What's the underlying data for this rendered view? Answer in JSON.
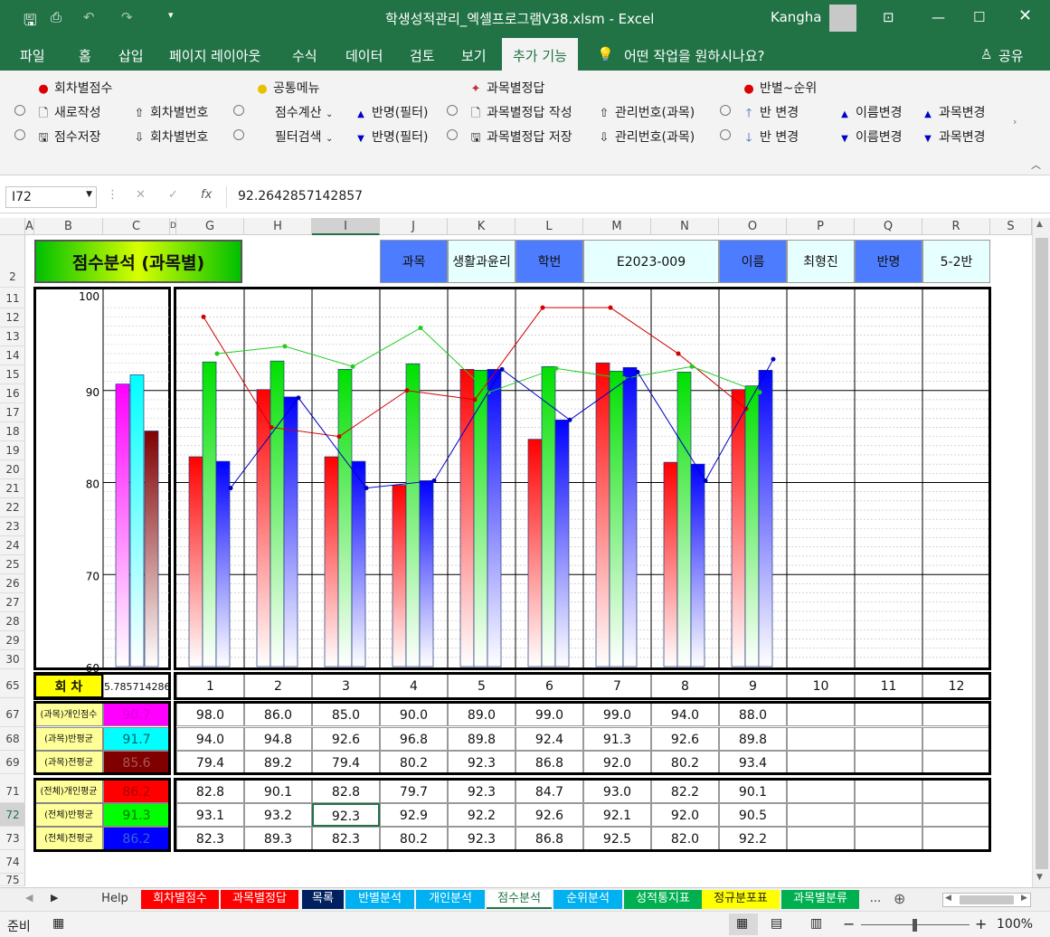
{
  "window": {
    "title": "학생성적관리_엑셀프로그램V38.xlsm  -  Excel",
    "user": "Kangha"
  },
  "tabs": [
    "파일",
    "홈",
    "삽입",
    "페이지 레이아웃",
    "수식",
    "데이터",
    "검토",
    "보기",
    "추가 기능"
  ],
  "tell_me": "어떤 작업을 원하시나요?",
  "share": "공유",
  "ribbon": {
    "g1": "회차별점수",
    "g2": "공통메뉴",
    "g3": "과목별정답",
    "g4": "반별~순위",
    "new": "새로작성",
    "save": "점수저장",
    "round_no_up": "회차별번호",
    "round_no_down": "회차별번호",
    "calc": "점수계산",
    "filter": "필터검색",
    "name_filter_up": "반명(필터)",
    "name_filter_down": "반명(필터)",
    "ans_make": "과목별정답 작성",
    "ans_save": "과목별정답 저장",
    "mgmt_up": "관리번호(과목)",
    "mgmt_down": "관리번호(과목)",
    "cls_up": "반 변경",
    "cls_down": "반 변경",
    "name_up": "이름변경",
    "name_down": "이름변경",
    "subj_up": "과목변경",
    "subj_down": "과목변경"
  },
  "formula": {
    "namebox": "I72",
    "value": "92.2642857142857",
    "fx": "fx"
  },
  "columns": [
    "A",
    "B",
    "C",
    "D",
    "G",
    "H",
    "I",
    "J",
    "K",
    "L",
    "M",
    "N",
    "O",
    "P",
    "Q",
    "R",
    "S"
  ],
  "rows": [
    "2",
    "11",
    "12",
    "13",
    "14",
    "15",
    "16",
    "17",
    "18",
    "19",
    "20",
    "21",
    "22",
    "23",
    "24",
    "25",
    "26",
    "27",
    "28",
    "29",
    "30",
    "65",
    "67",
    "68",
    "69",
    "71",
    "72",
    "73",
    "74",
    "75"
  ],
  "header": {
    "title": "점수분석 (과목별)",
    "subject_label": "과목",
    "subject_value": "생활과윤리",
    "id_label": "학번",
    "id_value": "E2023-009",
    "name_label": "이름",
    "name_value": "최형진",
    "class_label": "반명",
    "class_value": "5-2반"
  },
  "axis_labels": [
    "100",
    "90",
    "80",
    "70",
    "60"
  ],
  "round": {
    "label": "회  차",
    "value": "5.785714286",
    "numbers": [
      "1",
      "2",
      "3",
      "4",
      "5",
      "6",
      "7",
      "8",
      "9",
      "10",
      "11",
      "12"
    ]
  },
  "labels": {
    "subj_personal": "(과목)개인점수",
    "subj_class": "(과목)반평균",
    "subj_all": "(과목)전평균",
    "tot_personal": "(전체)개인평균",
    "tot_class": "(전체)반평균",
    "tot_all": "(전체)전평균"
  },
  "summary": {
    "subj_personal": "90.7",
    "subj_class": "91.7",
    "subj_all": "85.6",
    "tot_personal": "86.2",
    "tot_class": "91.3",
    "tot_all": "86.2"
  },
  "table": {
    "subj_personal": [
      "98.0",
      "86.0",
      "85.0",
      "90.0",
      "89.0",
      "99.0",
      "99.0",
      "94.0",
      "88.0"
    ],
    "subj_class": [
      "94.0",
      "94.8",
      "92.6",
      "96.8",
      "89.8",
      "92.4",
      "91.3",
      "92.6",
      "89.8"
    ],
    "subj_all": [
      "79.4",
      "89.2",
      "79.4",
      "80.2",
      "92.3",
      "86.8",
      "92.0",
      "80.2",
      "93.4"
    ],
    "tot_personal": [
      "82.8",
      "90.1",
      "82.8",
      "79.7",
      "92.3",
      "84.7",
      "93.0",
      "82.2",
      "90.1"
    ],
    "tot_class": [
      "93.1",
      "93.2",
      "92.3",
      "92.9",
      "92.2",
      "92.6",
      "92.1",
      "92.0",
      "90.5"
    ],
    "tot_all": [
      "82.3",
      "89.3",
      "82.3",
      "80.2",
      "92.3",
      "86.8",
      "92.5",
      "82.0",
      "92.2"
    ]
  },
  "chart_data": [
    {
      "type": "bar",
      "categories": [
        "1",
        "2",
        "3",
        "4",
        "5",
        "6",
        "7",
        "8",
        "9"
      ],
      "ylim": [
        60,
        100
      ],
      "series": [
        {
          "name": "(전체)개인평균",
          "values": [
            82.8,
            90.1,
            82.8,
            79.7,
            92.3,
            84.7,
            93.0,
            82.2,
            90.1
          ]
        },
        {
          "name": "(전체)반평균",
          "values": [
            93.1,
            93.2,
            92.3,
            92.9,
            92.2,
            92.6,
            92.1,
            92.0,
            90.5
          ]
        },
        {
          "name": "(전체)전평균",
          "values": [
            82.3,
            89.3,
            82.3,
            80.2,
            92.3,
            86.8,
            92.5,
            82.0,
            92.2
          ]
        }
      ]
    },
    {
      "type": "line",
      "categories": [
        "1",
        "2",
        "3",
        "4",
        "5",
        "6",
        "7",
        "8",
        "9"
      ],
      "ylim": [
        60,
        100
      ],
      "series": [
        {
          "name": "(과목)개인점수",
          "values": [
            98.0,
            86.0,
            85.0,
            90.0,
            89.0,
            99.0,
            99.0,
            94.0,
            88.0
          ]
        },
        {
          "name": "(과목)반평균",
          "values": [
            94.0,
            94.8,
            92.6,
            96.8,
            89.8,
            92.4,
            91.3,
            92.6,
            89.8
          ]
        },
        {
          "name": "(과목)전평균",
          "values": [
            79.4,
            89.2,
            79.4,
            80.2,
            92.3,
            86.8,
            92.0,
            80.2,
            93.4
          ]
        }
      ]
    },
    {
      "type": "bar",
      "categories": [
        "(과목)개인점수",
        "(과목)반평균",
        "(과목)전평균"
      ],
      "values": [
        90.7,
        91.7,
        85.6
      ],
      "ylim": [
        60,
        100
      ]
    }
  ],
  "sheets": [
    "Help",
    "회차별점수",
    "과목별정답",
    "목록",
    "반별분석",
    "개인분석",
    "점수분석",
    "순위분석",
    "성적통지표",
    "정규분포표",
    "과목별분류",
    "..."
  ],
  "status": {
    "ready": "준비",
    "zoom": "100%"
  },
  "colors": {
    "excel_green": "#217346",
    "red": "#ff0000",
    "green": "#00ff00",
    "blue": "#0000ff",
    "magenta": "#ff00ff",
    "cyan": "#00ffff",
    "maroon": "#800000"
  }
}
